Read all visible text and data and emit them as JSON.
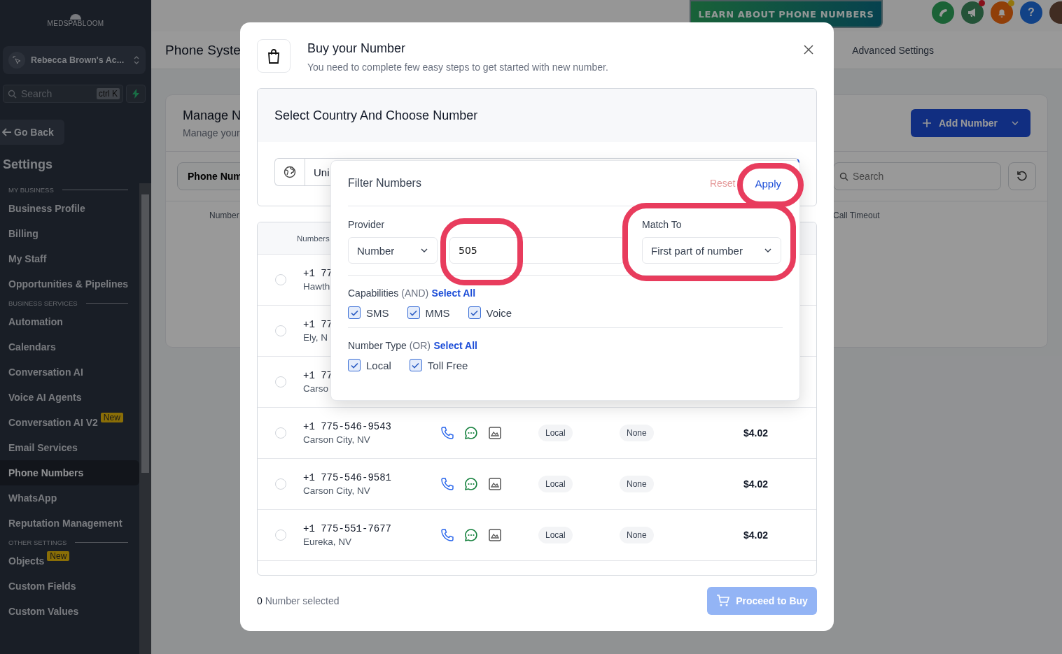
{
  "sidebar": {
    "logo": "MEDSPABLOOM",
    "account": "Rebecca Brown's Ac...",
    "search_placeholder": "Search",
    "shortcut": "ctrl K",
    "go_back": "Go Back",
    "title": "Settings",
    "sections": [
      {
        "heading": "MY BUSINESS",
        "items": [
          {
            "label": "Business Profile",
            "selected": false
          },
          {
            "label": "Billing",
            "selected": false
          },
          {
            "label": "My Staff",
            "selected": false
          },
          {
            "label": "Opportunities & Pipelines",
            "selected": false
          }
        ]
      },
      {
        "heading": "BUSINESS SERVICES",
        "items": [
          {
            "label": "Automation",
            "selected": false
          },
          {
            "label": "Calendars",
            "selected": false
          },
          {
            "label": "Conversation AI",
            "selected": false
          },
          {
            "label": "Voice AI Agents",
            "selected": false
          },
          {
            "label": "Conversation AI V2",
            "badge": "New",
            "selected": false
          },
          {
            "label": "Email Services",
            "selected": false
          },
          {
            "label": "Phone Numbers",
            "selected": true
          },
          {
            "label": "WhatsApp",
            "selected": false
          },
          {
            "label": "Reputation Management",
            "selected": false
          }
        ]
      },
      {
        "heading": "OTHER SETTINGS",
        "items": [
          {
            "label": "Objects",
            "badge": "New",
            "selected": false
          },
          {
            "label": "Custom Fields",
            "selected": false
          },
          {
            "label": "Custom Values",
            "selected": false
          }
        ]
      }
    ]
  },
  "topbar": {
    "learn_button": "LEARN ABOUT PHONE NUMBERS",
    "help_label": "?"
  },
  "page": {
    "title": "Phone Syste",
    "tab": "Advanced Settings",
    "card_title": "Manage N",
    "card_subtitle": "Manage your",
    "add_button": "Add Number",
    "phone_tab": "Phone Num",
    "search_placeholder": "Search",
    "columns": [
      "Number",
      "Call Timeout"
    ]
  },
  "modal": {
    "title": "Buy your Number",
    "subtitle": "You need to complete few easy steps to get started with new number.",
    "section_title": "Select Country And Choose Number",
    "country": "Uni",
    "table_header": "Numbers",
    "rows": [
      {
        "number": "+1 77",
        "city": "Hawth",
        "selected": false
      },
      {
        "number": "+1 77",
        "city": "Ely, N",
        "selected": false
      },
      {
        "number": "+1 77",
        "city": "Carso",
        "selected": false
      },
      {
        "number": "+1 775-546-9543",
        "city": "Carson City, NV",
        "type": "Local",
        "address": "None",
        "price": "$4.02",
        "selected": false
      },
      {
        "number": "+1 775-546-9581",
        "city": "Carson City, NV",
        "type": "Local",
        "address": "None",
        "price": "$4.02",
        "selected": false
      },
      {
        "number": "+1 775-551-7677",
        "city": "Eureka, NV",
        "type": "Local",
        "address": "None",
        "price": "$4.02",
        "selected": false
      }
    ],
    "selected_count": "0",
    "selected_label": "Number selected",
    "buy_button": "Proceed to Buy",
    "buy_disabled": true
  },
  "filter": {
    "title": "Filter Numbers",
    "reset": "Reset",
    "apply": "Apply",
    "provider_label": "Provider",
    "provider_value": "Number",
    "search_value": "505",
    "match_label": "Match To",
    "match_value": "First part of number",
    "groups": [
      {
        "label": "Capabilities",
        "qualifier": "(AND)",
        "select_all": "Select All",
        "options": [
          {
            "label": "SMS",
            "checked": true
          },
          {
            "label": "MMS",
            "checked": true
          },
          {
            "label": "Voice",
            "checked": true
          }
        ]
      },
      {
        "label": "Number Type",
        "qualifier": "(OR)",
        "select_all": "Select All",
        "options": [
          {
            "label": "Local",
            "checked": true
          },
          {
            "label": "Toll Free",
            "checked": true
          }
        ]
      }
    ]
  }
}
